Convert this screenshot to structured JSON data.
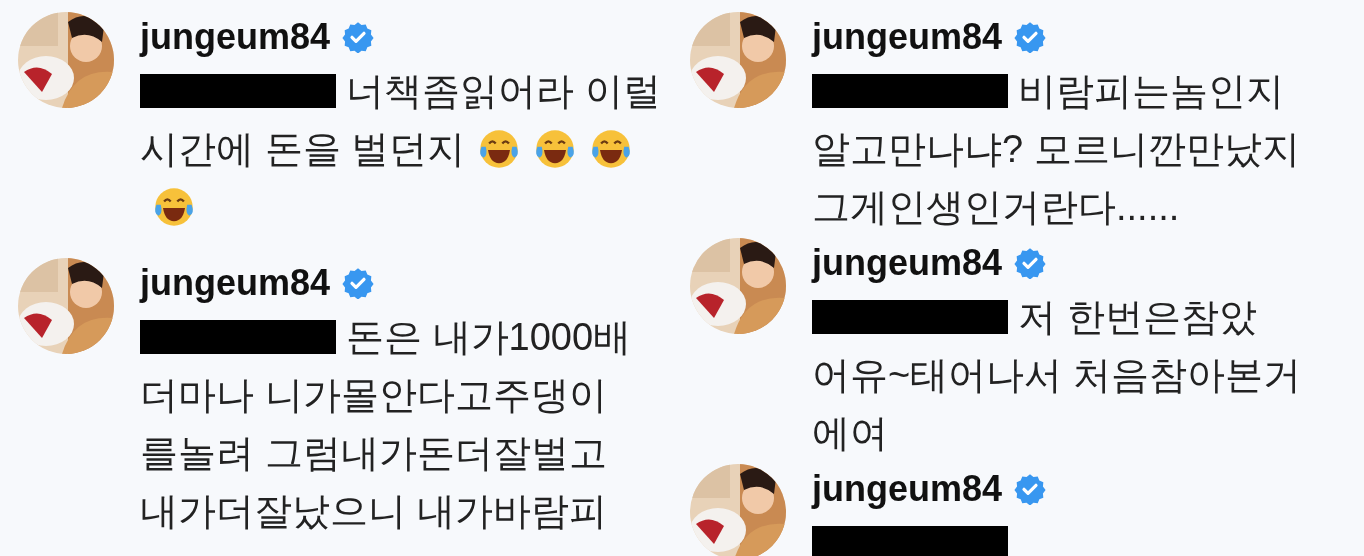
{
  "columns": [
    {
      "comments": [
        {
          "username": "jungeum84",
          "verified": true,
          "redacted": true,
          "lines": [
            {
              "text": "너책좀읽어라 이럴"
            },
            {
              "text": "시간에 돈을 벌던지",
              "emojis": [
                {
                  "kind": "tears-of-joy"
                },
                {
                  "kind": "tears-of-joy"
                },
                {
                  "kind": "tears-of-joy"
                }
              ]
            },
            {
              "emojis": [
                {
                  "kind": "tears-of-joy"
                }
              ]
            }
          ]
        },
        {
          "username": "jungeum84",
          "verified": true,
          "redacted": true,
          "lines": [
            {
              "text": "돈은 내가1000배"
            },
            {
              "text": "더마나 니가몰안다고주댕이"
            },
            {
              "text": "를놀려 그럼내가돈더잘벌고"
            },
            {
              "text": "내가더잘났으니 내가바람피"
            }
          ]
        }
      ]
    },
    {
      "comments": [
        {
          "username": "jungeum84",
          "verified": true,
          "redacted": true,
          "lines": [
            {
              "text": "비람피는놈인지"
            },
            {
              "text": "알고만나냐? 모르니깐만났지"
            },
            {
              "text": "그게인생인거란다......"
            }
          ]
        },
        {
          "username": "jungeum84",
          "verified": true,
          "redacted": true,
          "lines": [
            {
              "text": "저 한번은참았"
            },
            {
              "text": "어유~태어나서 처음참아본거"
            },
            {
              "text": "에여"
            }
          ]
        },
        {
          "username": "jungeum84",
          "verified": true,
          "redacted": true
        }
      ]
    }
  ]
}
